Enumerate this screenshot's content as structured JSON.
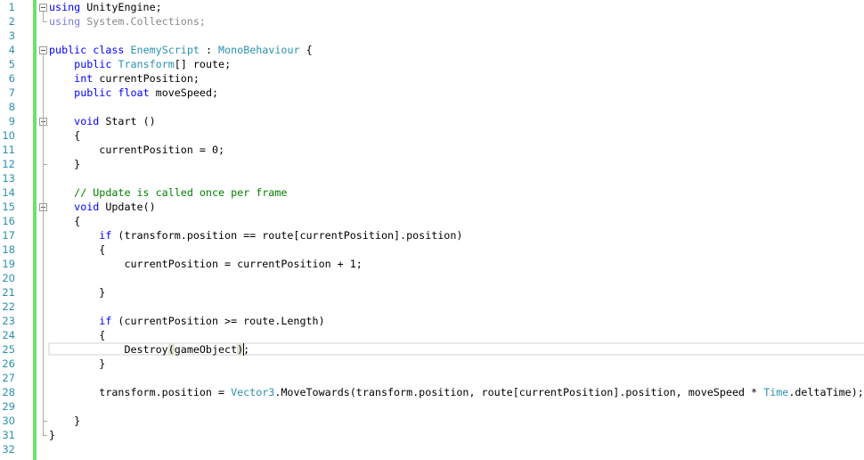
{
  "editor": {
    "current_line": 25,
    "colors": {
      "line_number": "#2b91af",
      "keyword": "#0000ff",
      "type": "#2b91af",
      "comment": "#008000",
      "change_bar": "#6ce26c"
    },
    "lines": [
      [
        [
          "using",
          "kw"
        ],
        [
          " UnityEngine;",
          ""
        ]
      ],
      [
        [
          "using",
          "fd"
        ],
        [
          " System.Collections;",
          "fdt"
        ]
      ],
      [],
      [
        [
          "public",
          "kw"
        ],
        [
          " ",
          ""
        ],
        [
          "class",
          "kw"
        ],
        [
          " ",
          ""
        ],
        [
          "EnemyScript",
          "ty"
        ],
        [
          " : ",
          ""
        ],
        [
          "MonoBehaviour",
          "ty"
        ],
        [
          " {",
          ""
        ]
      ],
      [
        [
          "    ",
          ""
        ],
        [
          "public",
          "kw"
        ],
        [
          " ",
          ""
        ],
        [
          "Transform",
          "ty"
        ],
        [
          "[] route;",
          ""
        ]
      ],
      [
        [
          "    ",
          ""
        ],
        [
          "int",
          "kw"
        ],
        [
          " currentPosition;",
          ""
        ]
      ],
      [
        [
          "    ",
          ""
        ],
        [
          "public",
          "kw"
        ],
        [
          " ",
          ""
        ],
        [
          "float",
          "kw"
        ],
        [
          " moveSpeed;",
          ""
        ]
      ],
      [],
      [
        [
          "    ",
          ""
        ],
        [
          "void",
          "kw"
        ],
        [
          " Start ()",
          ""
        ]
      ],
      [
        [
          "    {",
          ""
        ]
      ],
      [
        [
          "        currentPosition = 0;",
          ""
        ]
      ],
      [
        [
          "    }",
          ""
        ]
      ],
      [],
      [
        [
          "    ",
          ""
        ],
        [
          "// Update is called once per frame",
          "cm"
        ]
      ],
      [
        [
          "    ",
          ""
        ],
        [
          "void",
          "kw"
        ],
        [
          " Update()",
          ""
        ]
      ],
      [
        [
          "    {",
          ""
        ]
      ],
      [
        [
          "        ",
          ""
        ],
        [
          "if",
          "kw"
        ],
        [
          " (transform.position == route[currentPosition].position)",
          ""
        ]
      ],
      [
        [
          "        {",
          ""
        ]
      ],
      [
        [
          "            currentPosition = currentPosition + 1;",
          ""
        ]
      ],
      [],
      [
        [
          "        }",
          ""
        ]
      ],
      [],
      [
        [
          "        ",
          ""
        ],
        [
          "if",
          "kw"
        ],
        [
          " (currentPosition >= route.Length)",
          ""
        ]
      ],
      [
        [
          "        {",
          ""
        ]
      ],
      [
        [
          "            Destroy",
          ""
        ],
        [
          "(",
          "bm"
        ],
        [
          "gameObject",
          ""
        ],
        [
          ")",
          "bm"
        ],
        [
          ";",
          ""
        ]
      ],
      [
        [
          "        }",
          ""
        ]
      ],
      [],
      [
        [
          "        transform.position = ",
          ""
        ],
        [
          "Vector3",
          "ty"
        ],
        [
          ".MoveTowards(transform.position, route[currentPosition].position, moveSpeed * ",
          ""
        ],
        [
          "Time",
          "ty"
        ],
        [
          ".deltaTime);",
          ""
        ]
      ],
      [],
      [
        [
          "    }",
          ""
        ]
      ],
      [
        [
          "}",
          ""
        ]
      ],
      []
    ]
  }
}
